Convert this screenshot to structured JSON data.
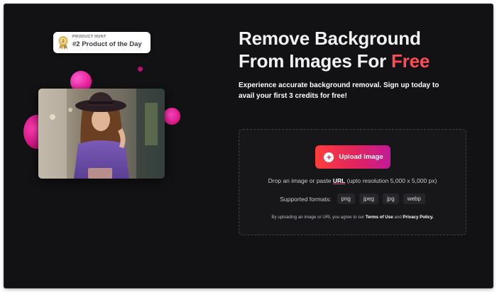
{
  "badge": {
    "kicker": "PRODUCT HUNT",
    "title": "#2 Product of the Day"
  },
  "hero": {
    "headline_line1": "Remove Background",
    "headline_line2_prefix": "From Images For ",
    "headline_accent": "Free",
    "subhead": "Experience accurate background removal. Sign up today to avail your first 3 credits for free!"
  },
  "upload": {
    "button_label": "Upload Image",
    "plus_glyph": "+",
    "drop_prefix": "Drop an image or paste ",
    "url_label": "URL",
    "drop_suffix": " (upto resolution 5,000 x 5,000 px)",
    "formats_label": "Supported formats:",
    "formats": [
      "png",
      "jpeg",
      "jpg",
      "webp"
    ],
    "terms_prefix": "By uploading an image or URL you agree to our ",
    "terms_link": "Terms of Use",
    "terms_and": " and ",
    "privacy_link": "Privacy Policy."
  },
  "colors": {
    "background": "#121215",
    "accent": "#ff4b55",
    "button_gradient_start": "#ff3d3d",
    "button_gradient_end": "#c21a98",
    "blob": "#e0168f"
  },
  "icons": {
    "badge": "medal-icon",
    "upload": "plus-circle-icon"
  }
}
